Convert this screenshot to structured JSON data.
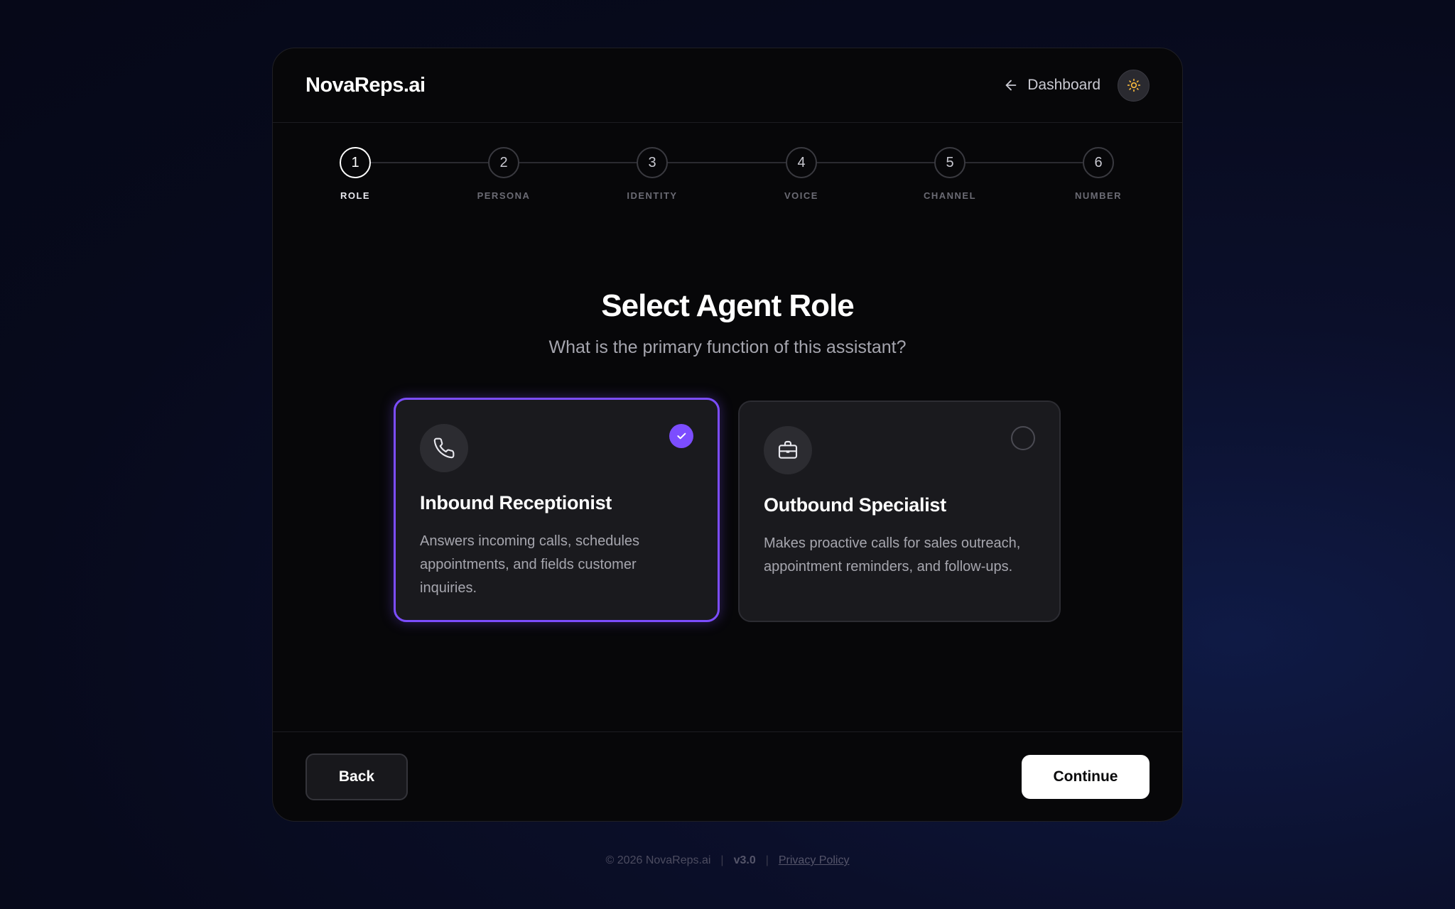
{
  "header": {
    "brand": "NovaReps.ai",
    "dashboard_label": "Dashboard"
  },
  "stepper": {
    "steps": [
      {
        "number": "1",
        "label": "ROLE",
        "active": true
      },
      {
        "number": "2",
        "label": "PERSONA",
        "active": false
      },
      {
        "number": "3",
        "label": "IDENTITY",
        "active": false
      },
      {
        "number": "4",
        "label": "VOICE",
        "active": false
      },
      {
        "number": "5",
        "label": "CHANNEL",
        "active": false
      },
      {
        "number": "6",
        "label": "NUMBER",
        "active": false
      }
    ]
  },
  "main": {
    "title": "Select Agent Role",
    "subtitle": "What is the primary function of this assistant?",
    "cards": [
      {
        "icon": "phone-icon",
        "title": "Inbound Receptionist",
        "description": "Answers incoming calls, schedules appointments, and fields customer inquiries.",
        "selected": true
      },
      {
        "icon": "briefcase-icon",
        "title": "Outbound Specialist",
        "description": "Makes proactive calls for sales outreach, appointment reminders, and follow-ups.",
        "selected": false
      }
    ]
  },
  "actions": {
    "back_label": "Back",
    "continue_label": "Continue"
  },
  "footer": {
    "copyright": "© 2026 NovaReps.ai",
    "version": "v3.0",
    "privacy": "Privacy Policy"
  },
  "colors": {
    "accent": "#7c4dff",
    "theme_icon": "#f5b83d"
  }
}
